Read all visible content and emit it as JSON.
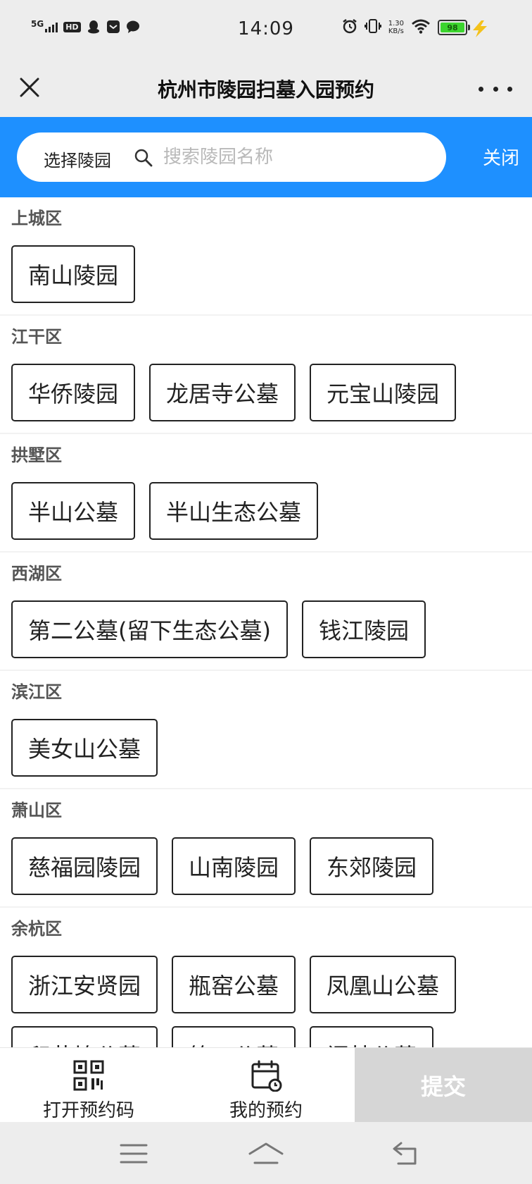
{
  "status_bar": {
    "network": "5G",
    "hd": "HD",
    "time": "14:09",
    "speed_value": "1.30",
    "speed_unit": "KB/s",
    "battery": "98",
    "icons": [
      "penguin-icon",
      "mail-icon",
      "chat-icon",
      "alarm-icon",
      "vibrate-icon",
      "wifi-icon",
      "charging-icon"
    ]
  },
  "title_bar": {
    "title": "杭州市陵园扫墓入园预约",
    "close_icon": "close-icon",
    "more_icon": "more-icon"
  },
  "search": {
    "select_label": "选择陵园",
    "placeholder": "搜索陵园名称",
    "value": "",
    "close_label": "关闭",
    "accent_color": "#1e90ff"
  },
  "districts": [
    {
      "name": "上城区",
      "cemeteries": [
        "南山陵园"
      ]
    },
    {
      "name": "江干区",
      "cemeteries": [
        "华侨陵园",
        "龙居寺公墓",
        "元宝山陵园"
      ]
    },
    {
      "name": "拱墅区",
      "cemeteries": [
        "半山公墓",
        "半山生态公墓"
      ]
    },
    {
      "name": "西湖区",
      "cemeteries": [
        "第二公墓(留下生态公墓)",
        "钱江陵园"
      ]
    },
    {
      "name": "滨江区",
      "cemeteries": [
        "美女山公墓"
      ]
    },
    {
      "name": "萧山区",
      "cemeteries": [
        "慈福园陵园",
        "山南陵园",
        "东郊陵园"
      ]
    },
    {
      "name": "余杭区",
      "cemeteries": [
        "浙江安贤园",
        "瓶窑公墓",
        "凤凰山公墓",
        "印花坞公墓",
        "第三公墓",
        "闲林公墓"
      ]
    }
  ],
  "bottom_bar": {
    "open_code_label": "打开预约码",
    "my_booking_label": "我的预约",
    "submit_label": "提交",
    "submit_color": "#d6d6d6"
  },
  "system_nav": {
    "icons": [
      "menu-icon",
      "home-icon",
      "back-icon"
    ]
  }
}
